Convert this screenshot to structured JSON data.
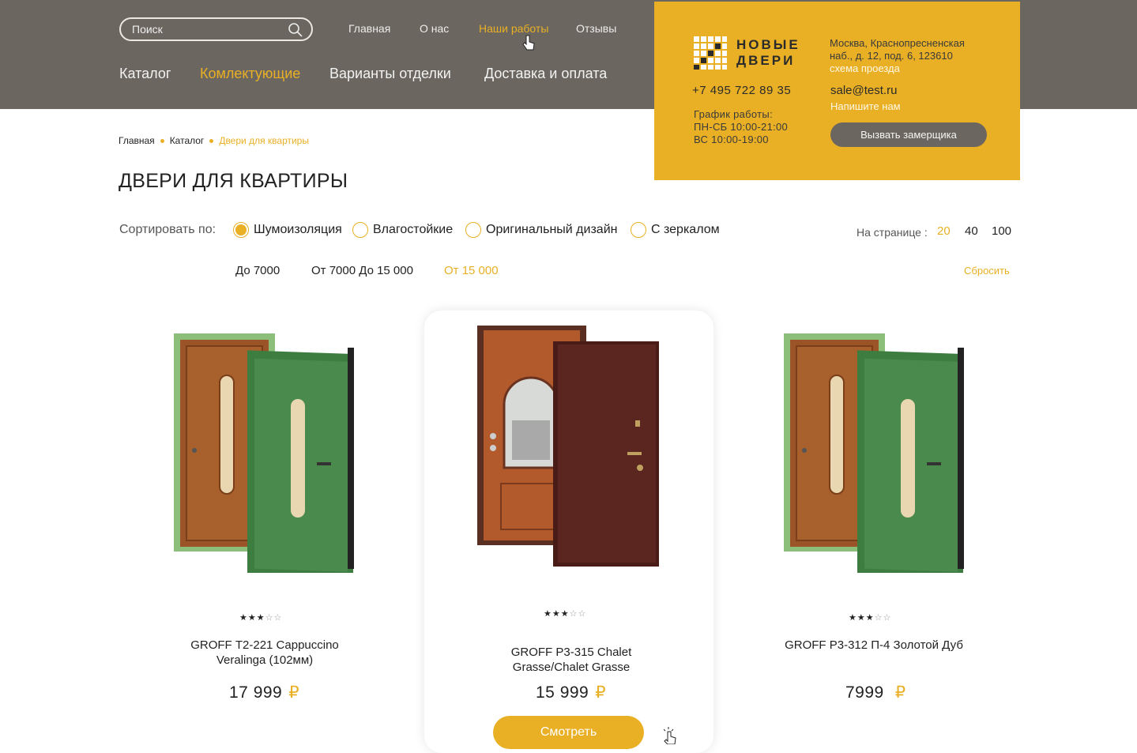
{
  "header": {
    "search_placeholder": "Поиск",
    "top_nav": [
      "Главная",
      "О нас",
      "Наши работы",
      "Отзывы"
    ],
    "main_nav": [
      "Каталог",
      "Комлектующие",
      "Варианты отделки",
      "Доставка и оплата"
    ]
  },
  "contact": {
    "logo_line1": "НОВЫЕ",
    "logo_line2": "ДВЕРИ",
    "phone": "+7 495 722 89 35",
    "hours_title": "График работы:",
    "hours_weekdays": "ПН-СБ 10:00-21:00",
    "hours_sunday": "ВС 10:00-19:00",
    "address_line1": "Москва, Краснопресненская",
    "address_line2": "наб., д. 12, под. 6, 123610",
    "route_link": "схема проезда",
    "email": "sale@test.ru",
    "write_link": "Напишите нам",
    "call_button": "Вызвать замерщика"
  },
  "breadcrumbs": [
    "Главная",
    "Каталог",
    "Двери для квартиры"
  ],
  "page_title": "ДВЕРИ ДЛЯ КВАРТИРЫ",
  "sort": {
    "label": "Сортировать по:",
    "options": [
      "Шумоизоляция",
      "Влагостойкие",
      "Оригинальный дизайн",
      "С зеркалом"
    ],
    "selected": "Шумоизоляция"
  },
  "per_page": {
    "label": "На странице :",
    "options": [
      "20",
      "40",
      "100"
    ],
    "selected": "20"
  },
  "price_filter": {
    "options": [
      "До 7000",
      "От 7000 До 15 000",
      "От 15 000"
    ],
    "selected": "От 15 000",
    "reset": "Сбросить"
  },
  "products": [
    {
      "name_line1": "GROFF Т2-221 Cappuccino",
      "name_line2": "Veralinga (102мм)",
      "price": "17 999",
      "rating": 3
    },
    {
      "name_line1": "GROFF Р3-315 Chalet",
      "name_line2": "Grasse/Chalet Grasse",
      "price": "15 999",
      "rating": 3
    },
    {
      "name_line1": "GROFF Р3-312 П-4 Золотой Дуб",
      "name_line2": "",
      "price": "7999",
      "rating": 3
    }
  ],
  "currency": "₽",
  "view_button": "Смотреть",
  "colors": {
    "accent": "#e9b025",
    "header_bg": "#6b6660",
    "text": "#222222"
  }
}
